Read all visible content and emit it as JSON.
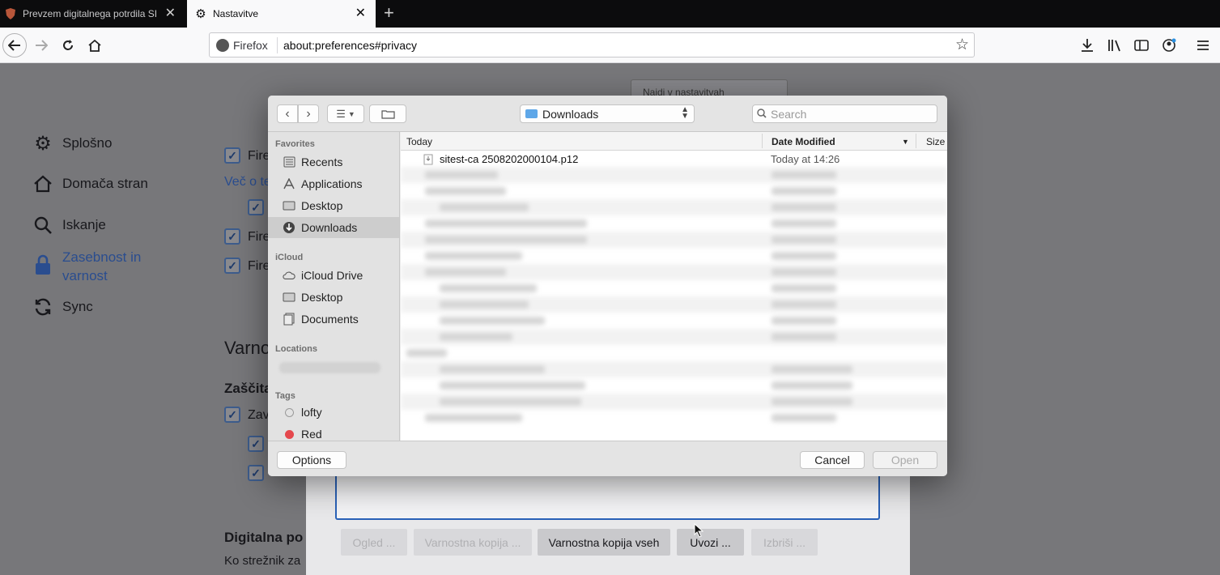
{
  "tabs": [
    {
      "title": "Prevzem digitalnega potrdila SI",
      "close": "✕"
    },
    {
      "title": "Nastavitve",
      "close": "✕"
    }
  ],
  "new_tab": "+",
  "toolbar": {
    "identity": "Firefox",
    "url": "about:preferences#privacy"
  },
  "prefs": {
    "search_placeholder": "Najdi v nastavitvah",
    "sidebar": [
      {
        "label": "Splošno",
        "icon": "gear-icon"
      },
      {
        "label": "Domača stran",
        "icon": "home-icon"
      },
      {
        "label": "Iskanje",
        "icon": "search-icon"
      },
      {
        "label": "Zasebnost in varnost",
        "icon": "lock-icon"
      },
      {
        "label": "Sync",
        "icon": "sync-icon"
      }
    ],
    "content": {
      "fire_1": "Fire",
      "vec_link": "Več o te",
      "fire_2": "Fire",
      "fire_3": "Fire",
      "varno_heading": "Varno",
      "zascita_heading": "Zaščita",
      "zav": "Zav",
      "digitalna_heading": "Digitalna po",
      "streznik_text": "Ko strežnik za"
    },
    "cert_buttons": [
      "Ogled ...",
      "Varnostna kopija ...",
      "Varnostna kopija vseh",
      "Uvozi ...",
      "Izbriši ..."
    ]
  },
  "dialog": {
    "location": "Downloads",
    "search_placeholder": "Search",
    "sidebar": {
      "favorites_header": "Favorites",
      "favorites": [
        "Recents",
        "Applications",
        "Desktop",
        "Downloads"
      ],
      "icloud_header": "iCloud",
      "icloud": [
        "iCloud Drive",
        "Desktop",
        "Documents"
      ],
      "locations_header": "Locations",
      "tags_header": "Tags",
      "tags": [
        {
          "name": "lofty",
          "color": "#cfcfcf"
        },
        {
          "name": "Red",
          "color": "#e5484d"
        }
      ]
    },
    "columns": {
      "name": "Today",
      "date": "Date Modified",
      "size": "Size"
    },
    "file": {
      "name": "sitest-ca 2508202000104.p12",
      "date": "Today at 14:26"
    },
    "options_label": "Options",
    "cancel_label": "Cancel",
    "open_label": "Open"
  }
}
